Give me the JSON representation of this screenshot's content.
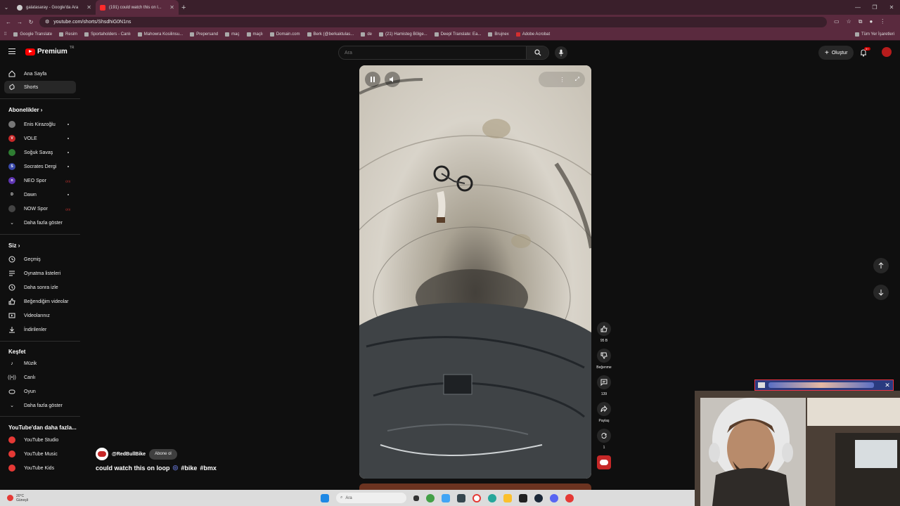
{
  "browser": {
    "tabs": [
      {
        "label": "galatasaray - Google'da Ara",
        "active": false
      },
      {
        "label": "(191) could watch this on l...",
        "active": true
      }
    ],
    "url": "youtube.com/shorts/ShsdhiG0N1ns",
    "bookmarks": [
      "Google Translate",
      "Resim",
      "Sportaholders - Canlı",
      "Mahowra Kosilinsu...",
      "Prepersand",
      "maç",
      "maçlı",
      "Domain.com",
      "Berk (@berkaktulas...",
      "de",
      "(21) Hamisteg Bölge...",
      "Deepl Translate: Ea...",
      "Brujnex",
      "Adobe Acrobat"
    ],
    "bookmarks_right": "Tüm Yer İşaretleri"
  },
  "header": {
    "logo_text": "Premium",
    "logo_region": "TR",
    "search_placeholder": "Ara",
    "create_label": "Oluştur",
    "notification_count": "9+"
  },
  "sidebar": {
    "main": [
      {
        "label": "Ana Sayfa",
        "icon": "home-icon"
      },
      {
        "label": "Shorts",
        "icon": "shorts-icon",
        "active": true
      }
    ],
    "subs_heading": "Abonelikler",
    "subscriptions": [
      {
        "label": "Enis Kirazoğlu",
        "color": "#777777",
        "live": false
      },
      {
        "label": "VOLE",
        "color": "#c62828",
        "live": false
      },
      {
        "label": "Soğuk Savaş",
        "color": "#2e7d32",
        "live": false
      },
      {
        "label": "Socrates Dergi",
        "color": "#3949ab",
        "live": false
      },
      {
        "label": "NEO Spor",
        "color": "#5e35b1",
        "live": true
      },
      {
        "label": "Dawn",
        "color": "#111111",
        "live": false
      },
      {
        "label": "NOW Spor",
        "color": "#444444",
        "live": true
      }
    ],
    "subs_more": "Daha fazla göster",
    "you_heading": "Siz",
    "you": [
      {
        "label": "Geçmiş",
        "icon": "history-icon"
      },
      {
        "label": "Oynatma listeleri",
        "icon": "playlists-icon"
      },
      {
        "label": "Daha sonra izle",
        "icon": "watch-later-icon"
      },
      {
        "label": "Beğendiğim videolar",
        "icon": "liked-videos-icon"
      },
      {
        "label": "Videolarınız",
        "icon": "your-videos-icon"
      },
      {
        "label": "İndirilenler",
        "icon": "downloads-icon"
      }
    ],
    "explore_heading": "Keşfet",
    "explore": [
      {
        "label": "Müzik",
        "icon": "music-icon"
      },
      {
        "label": "Canlı",
        "icon": "live-icon"
      },
      {
        "label": "Oyun",
        "icon": "gaming-icon"
      }
    ],
    "explore_more": "Daha fazla göster",
    "more_heading": "YouTube'dan daha fazla...",
    "more": [
      {
        "label": "YouTube Studio"
      },
      {
        "label": "YouTube Music"
      },
      {
        "label": "YouTube Kids"
      }
    ]
  },
  "short": {
    "channel": "@RedBullBike",
    "subscribe_label": "Abone ol",
    "title_text": "could watch this on loop",
    "hashtags": [
      "#bike",
      "#bmx"
    ],
    "likes": "95 B",
    "dislike_label": "Beğenme",
    "comments": "139",
    "share_label": "Paylaş",
    "remix_count": "1"
  },
  "taskbar": {
    "temp": "20°C",
    "weather": "Güneşli",
    "search_placeholder": "Ara"
  },
  "colors": {
    "accent": "#ff0000",
    "chrome": "#5a2a3e",
    "background": "#0f0f0f"
  }
}
